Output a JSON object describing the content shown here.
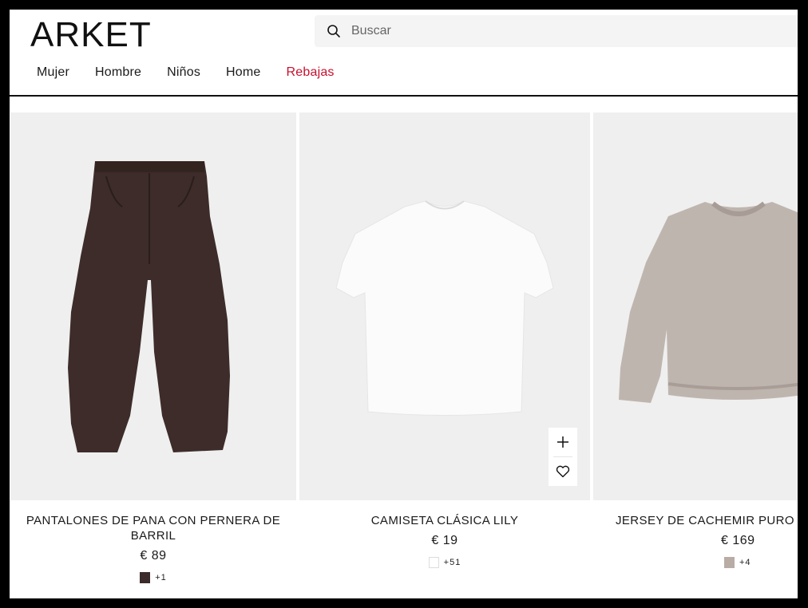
{
  "header": {
    "logo": "ARKET",
    "search_placeholder": "Buscar"
  },
  "nav": [
    {
      "label": "Mujer"
    },
    {
      "label": "Hombre"
    },
    {
      "label": "Niños"
    },
    {
      "label": "Home"
    },
    {
      "label": "Rebajas",
      "color": "#c8102e"
    }
  ],
  "products": [
    {
      "name": "PANTALONES DE PANA CON PERNERA DE BARRIL",
      "price": "€ 89",
      "swatch_color": "#3b2b2a",
      "more_colors": "+1"
    },
    {
      "name": "CAMISETA CLÁSICA LILY",
      "price": "€ 19",
      "swatch_color": "#ffffff",
      "more_colors": "+51"
    },
    {
      "name": "JERSEY DE CACHEMIR PURO",
      "price": "€ 169",
      "swatch_color": "#b8aca5",
      "more_colors": "+4"
    }
  ]
}
